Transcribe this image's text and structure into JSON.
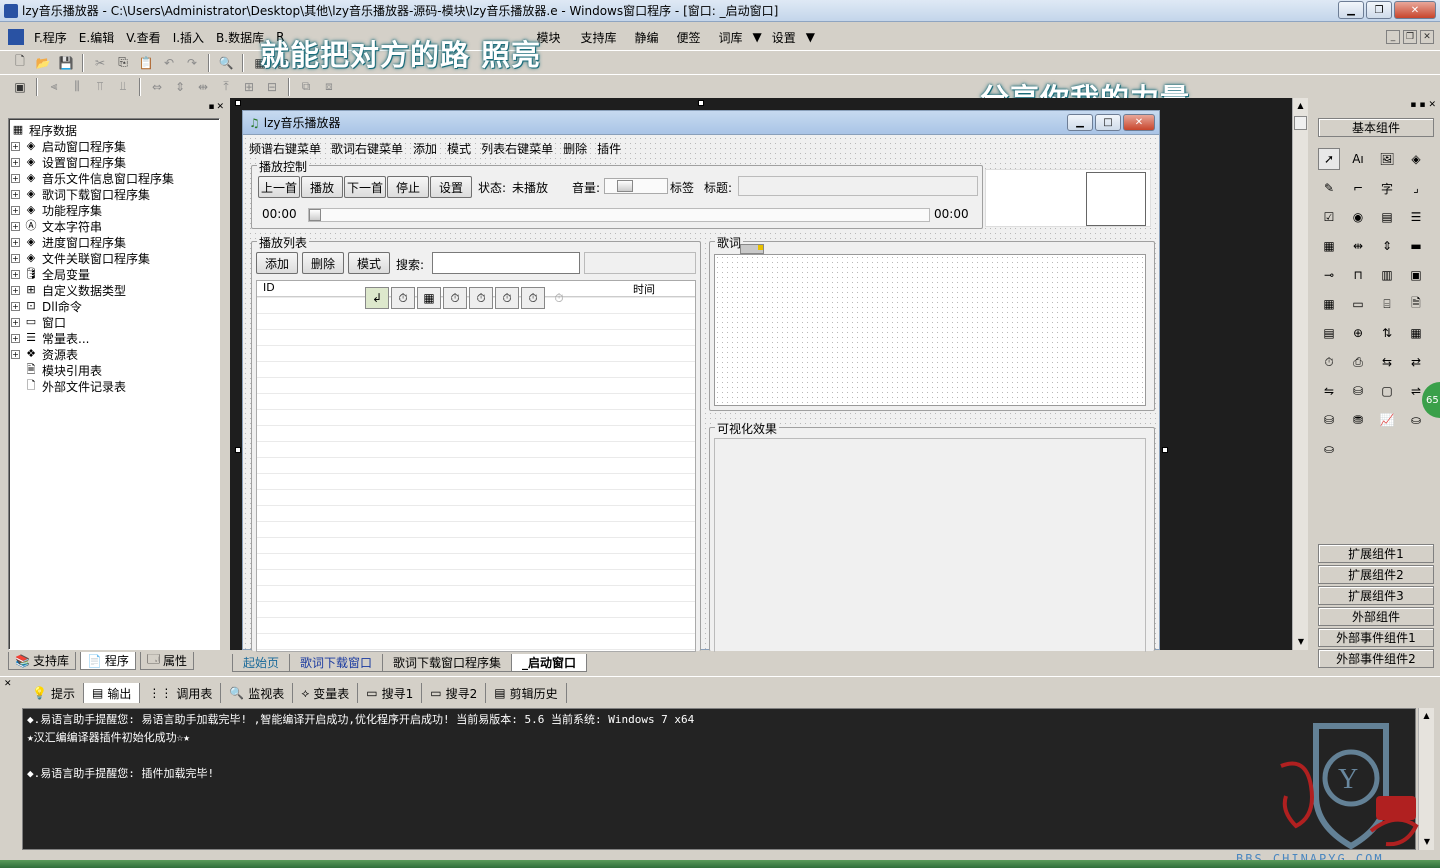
{
  "window": {
    "title": "lzy音乐播放器 - C:\\Users\\Administrator\\Desktop\\其他\\lzy音乐播放器-源码-模块\\lzy音乐播放器.e - Windows窗口程序 - [窗口: _启动窗口]"
  },
  "menu": [
    "F.程序",
    "E.编辑",
    "V.查看",
    "I.插入",
    "B.数据库",
    "R",
    "模块",
    "支持库",
    "静编",
    "便签",
    "词库",
    "设置"
  ],
  "overlay": {
    "text1": "就能把对方的路 照亮",
    "text2": "分享你我的力量"
  },
  "project_tree": {
    "root": "程序数据",
    "items": [
      {
        "label": "启动窗口程序集",
        "icon": "module-icon"
      },
      {
        "label": "设置窗口程序集",
        "icon": "module-icon"
      },
      {
        "label": "音乐文件信息窗口程序集",
        "icon": "module-icon"
      },
      {
        "label": "歌词下载窗口程序集",
        "icon": "module-icon"
      },
      {
        "label": "功能程序集",
        "icon": "module-icon"
      },
      {
        "label": "文本字符串",
        "icon": "text-icon"
      },
      {
        "label": "进度窗口程序集",
        "icon": "module-icon"
      },
      {
        "label": "文件关联窗口程序集",
        "icon": "module-icon"
      },
      {
        "label": "全局变量",
        "icon": "variable-icon"
      },
      {
        "label": "自定义数据类型",
        "icon": "datatype-icon"
      },
      {
        "label": "Dll命令",
        "icon": "dll-icon"
      },
      {
        "label": "窗口",
        "icon": "window-icon"
      },
      {
        "label": "常量表...",
        "icon": "constant-icon"
      },
      {
        "label": "资源表",
        "icon": "resource-icon"
      },
      {
        "label": "模块引用表",
        "icon": "module-ref-icon"
      },
      {
        "label": "外部文件记录表",
        "icon": "file-icon"
      }
    ],
    "tabs": [
      "支持库",
      "程序",
      "属性"
    ]
  },
  "form": {
    "title": "lzy音乐播放器",
    "menu": [
      "频谱右键菜单",
      "歌词右键菜单",
      "添加",
      "模式",
      "列表右键菜单",
      "删除",
      "插件"
    ],
    "playback": {
      "group": "播放控制",
      "buttons": [
        "上一首",
        "播放",
        "下一首",
        "停止",
        "设置"
      ],
      "status_label": "状态:",
      "status_value": "未播放",
      "volume_label": "音量:",
      "tag_label": "标签",
      "caption_label": "标题:",
      "time_start": "00:00",
      "time_end": "00:00"
    },
    "playlist": {
      "group": "播放列表",
      "buttons": [
        "添加",
        "删除",
        "模式"
      ],
      "search_label": "搜索:",
      "columns": [
        "ID",
        "时间"
      ]
    },
    "lyrics": {
      "group": "歌词"
    },
    "visual": {
      "group": "可视化效果"
    }
  },
  "components": {
    "title": "基本组件",
    "groups": [
      "扩展组件1",
      "扩展组件2",
      "扩展组件3",
      "外部组件",
      "外部事件组件1",
      "外部事件组件2"
    ],
    "badge": "65"
  },
  "editor_tabs": [
    "起始页",
    "歌词下载窗口",
    "歌词下载窗口程序集",
    "_启动窗口"
  ],
  "output_tabs": [
    "提示",
    "输出",
    "调用表",
    "监视表",
    "变量表",
    "搜寻1",
    "搜寻2",
    "剪辑历史"
  ],
  "output_lines": [
    "◆.易语言助手提醒您: 易语言助手加载完毕!  ,智能编译开启成功,优化程序开启成功!  当前易版本: 5.6  当前系统: Windows 7 x64",
    "★汉汇编编译器插件初始化成功☆★",
    "",
    "◆.易语言助手提醒您: 插件加载完毕!"
  ],
  "watermark": "BBS.CHINAPYG.COM"
}
